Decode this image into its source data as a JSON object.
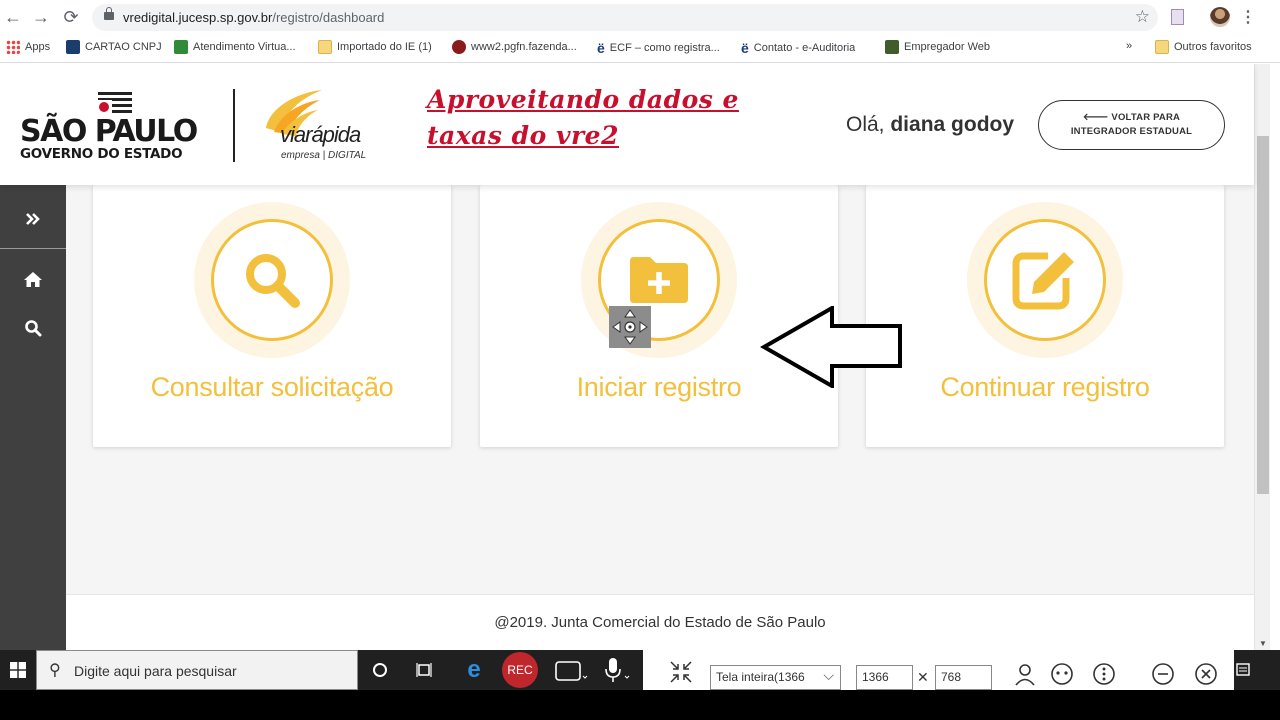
{
  "browser": {
    "url_host": "vredigital.jucesp.sp.gov.br",
    "url_path": "/registro/dashboard",
    "bookmarks": [
      {
        "label": "Apps",
        "icon": "apps-grid-icon"
      },
      {
        "label": "CARTAO CNPJ",
        "icon": "cnpj-icon"
      },
      {
        "label": "Atendimento Virtua...",
        "icon": "brazil-flag-icon"
      },
      {
        "label": "Importado do IE (1)",
        "icon": "folder-icon"
      },
      {
        "label": "www2.pgfn.fazenda...",
        "icon": "fazenda-icon"
      },
      {
        "label": "ECF – como registra...",
        "icon": "e-icon"
      },
      {
        "label": "Contato - e-Auditoria",
        "icon": "e-icon"
      },
      {
        "label": "Empregador Web",
        "icon": "empregador-icon"
      }
    ],
    "overflow": "»",
    "other_bookmarks": "Outros favoritos"
  },
  "header": {
    "sp_logo_title": "SÃO PAULO",
    "sp_logo_subtitle": "GOVERNO DO ESTADO",
    "via_logo_title": "viarápida",
    "via_logo_subtitle": "empresa | DIGITAL",
    "promo_line1": "Aproveitando dados e",
    "promo_line2": "taxas do vre2",
    "greeting_prefix": "Olá,",
    "user_name": "diana godoy",
    "back_button_line1": "🡐 VOLTAR PARA",
    "back_button_line2": "INTEGRADOR ESTADUAL"
  },
  "sidebar": {
    "items": [
      {
        "name": "expand",
        "icon": "double-chevron-right-icon"
      },
      {
        "name": "home",
        "icon": "home-icon"
      },
      {
        "name": "search",
        "icon": "search-icon"
      }
    ]
  },
  "cards": [
    {
      "label": "Consultar solicitação",
      "icon": "search-icon"
    },
    {
      "label": "Iniciar registro",
      "icon": "folder-plus-icon"
    },
    {
      "label": "Continuar registro",
      "icon": "edit-icon"
    }
  ],
  "footer": {
    "text": "@2019. Junta Comercial do Estado de São Paulo"
  },
  "taskbar": {
    "search_placeholder": "Digite aqui para pesquisar",
    "rec_label": "REC",
    "capture_mode": "Tela inteira(1366",
    "width_value": "1366",
    "height_value": "768",
    "dim_separator": "✕"
  },
  "colors": {
    "accent_yellow": "#f3c03d",
    "sidebar": "#404040",
    "promo_red": "#c8102e"
  }
}
